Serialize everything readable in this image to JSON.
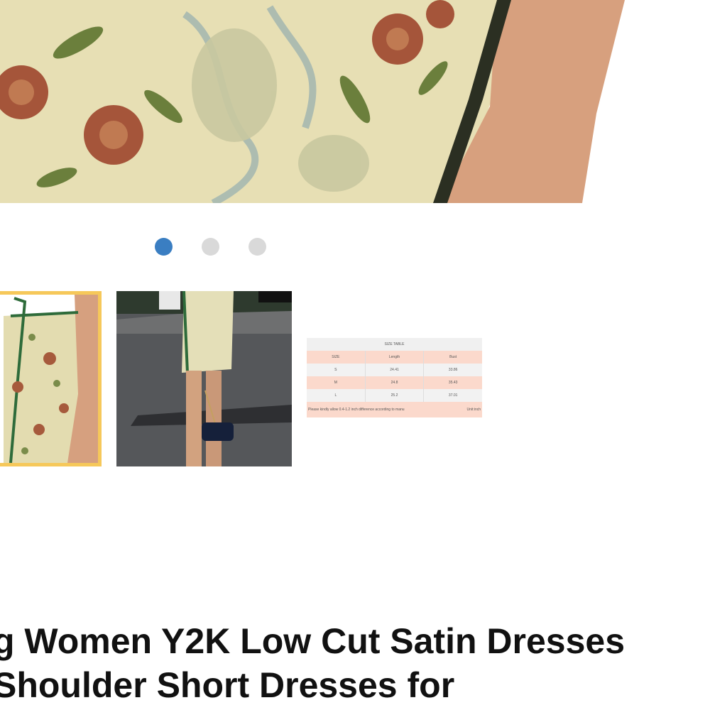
{
  "gallery": {
    "current_index": 1,
    "dot_count": 3,
    "colors": {
      "active_dot": "#3a7ec2",
      "inactive_dot": "#d9d9d9",
      "selected_border": "#f6c85a"
    }
  },
  "size_table": {
    "title": "SIZE TABLE",
    "headers": [
      "SIZE",
      "Length",
      "Bust"
    ],
    "rows": [
      [
        "S",
        "24.41",
        "33.86"
      ],
      [
        "M",
        "24.8",
        "35.43"
      ],
      [
        "L",
        "25.2",
        "37.01"
      ]
    ],
    "note": "Please kindly allow 0.4-1.2 inch difference according to manu",
    "unit": "Unit:inch"
  },
  "product": {
    "title_line1": "g Women Y2K Low Cut Satin Dresses",
    "title_line2": "Shoulder Short Dresses for"
  }
}
